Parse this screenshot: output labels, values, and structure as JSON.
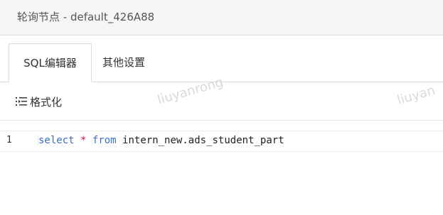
{
  "header": {
    "title": "轮询节点 - default_426A88"
  },
  "tabs": [
    {
      "label": "SQL编辑器",
      "active": true
    },
    {
      "label": "其他设置",
      "active": false
    }
  ],
  "toolbar": {
    "format_label": "格式化",
    "format_icon": "format-icon"
  },
  "watermarks": [
    "liuyanrong",
    "liuyan"
  ],
  "editor": {
    "line_number": "1",
    "tokens": {
      "kw_select": "select",
      "star": "*",
      "kw_from": "from",
      "table": "intern_new.ads_student_part"
    }
  },
  "colors": {
    "keyword": "#3b6fc2",
    "operator": "#d14",
    "header_bg": "#f5f5f5"
  }
}
